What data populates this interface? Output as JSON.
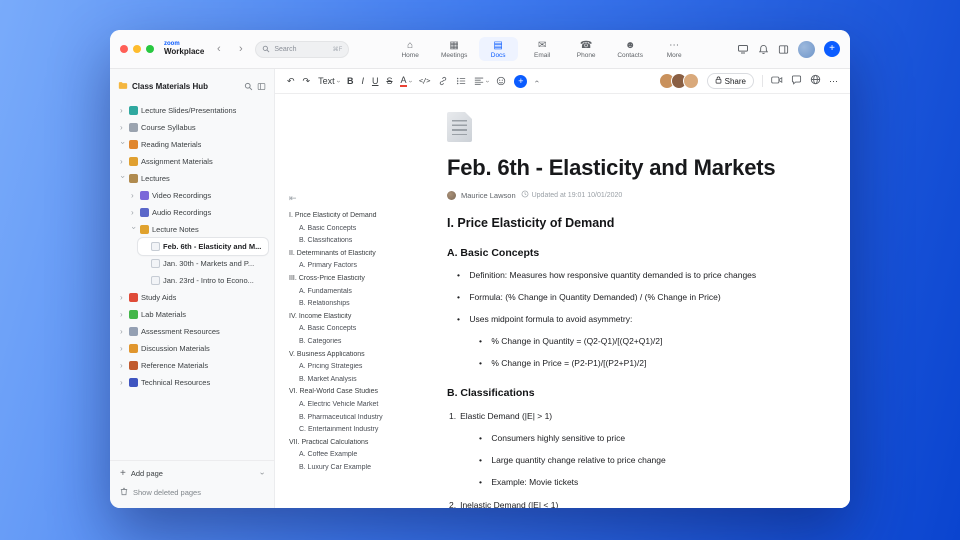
{
  "accent_color": "#0b5cff",
  "window": {
    "traffic_lights": [
      {
        "color": "#ff5f57"
      },
      {
        "color": "#febc2e"
      },
      {
        "color": "#28c840"
      }
    ]
  },
  "topbar": {
    "brand_zoom": "zoom",
    "brand_workplace": "Workplace",
    "search_placeholder": "Search",
    "search_shortcut": "⌘F",
    "tabs": [
      {
        "icon": "⌂",
        "label": "Home",
        "active": false
      },
      {
        "icon": "▦",
        "label": "Meetings",
        "active": false
      },
      {
        "icon": "▤",
        "label": "Docs",
        "active": true
      },
      {
        "icon": "✉",
        "label": "Email",
        "active": false
      },
      {
        "icon": "☎",
        "label": "Phone",
        "active": false
      },
      {
        "icon": "☻",
        "label": "Contacts",
        "active": false
      },
      {
        "icon": "⋯",
        "label": "More",
        "active": false
      }
    ],
    "new_button_label": "+",
    "right_icon_names": [
      "screen-share-icon",
      "bell-icon",
      "panel-layout-icon",
      "user-avatar",
      "new-button"
    ]
  },
  "sidebar": {
    "title": "Class Materials Hub",
    "items": [
      {
        "depth": 0,
        "label": "Lecture Slides/Presentations",
        "color": "#2fa89f"
      },
      {
        "depth": 0,
        "label": "Course Syllabus",
        "color": "#9aa3af"
      },
      {
        "depth": 0,
        "label": "Reading Materials",
        "color": "#e0862e",
        "expanded": true
      },
      {
        "depth": 0,
        "label": "Assignment Materials",
        "color": "#e0a030"
      },
      {
        "depth": 0,
        "label": "Lectures",
        "color": "#b08b4f",
        "expanded": true
      },
      {
        "depth": 1,
        "label": "Video Recordings",
        "color": "#7b68d9"
      },
      {
        "depth": 1,
        "label": "Audio Recordings",
        "color": "#5a67c9"
      },
      {
        "depth": 1,
        "label": "Lecture Notes",
        "color": "#e0a22e",
        "expanded": true
      },
      {
        "depth": 2,
        "label": "Feb. 6th - Elasticity and M...",
        "color": "#f2f4f7",
        "leaf": true,
        "selected": true
      },
      {
        "depth": 2,
        "label": "Jan. 30th - Markets and P...",
        "color": "#f2f4f7",
        "leaf": true
      },
      {
        "depth": 2,
        "label": "Jan. 23rd - Intro to Econo...",
        "color": "#f2f4f7",
        "leaf": true
      },
      {
        "depth": 0,
        "label": "Study Aids",
        "color": "#df4b38"
      },
      {
        "depth": 0,
        "label": "Lab Materials",
        "color": "#43b649"
      },
      {
        "depth": 0,
        "label": "Assessment Resources",
        "color": "#94a0b3"
      },
      {
        "depth": 0,
        "label": "Discussion Materials",
        "color": "#e0962e"
      },
      {
        "depth": 0,
        "label": "Reference Materials",
        "color": "#c05a2e"
      },
      {
        "depth": 0,
        "label": "Technical Resources",
        "color": "#3f55c0"
      }
    ],
    "add_page_label": "Add page",
    "show_deleted_label": "Show deleted pages"
  },
  "toolbar": {
    "undo_glyph": "↶",
    "redo_glyph": "↷",
    "text_style_label": "Text",
    "bold_label": "B",
    "italic_label": "I",
    "underline_label": "U",
    "strike_label": "S",
    "color_label": "A",
    "code_label": "</>",
    "share_label": "Share",
    "more_glyph": "⋯",
    "icon_names": [
      "link-icon",
      "bulleted-list-icon",
      "align-icon",
      "emoji-icon",
      "insert-plus-icon",
      "collapse-toolbar-icon",
      "video-icon",
      "comment-icon",
      "globe-icon",
      "more-icon"
    ],
    "avatars": [
      {
        "color": "#c9915c"
      },
      {
        "color": "#8a5f43"
      },
      {
        "color": "#d9a97b"
      }
    ]
  },
  "document": {
    "title": "Feb. 6th - Elasticity and Markets",
    "author": "Maurice Lawson",
    "updated": "Updated at 19:01 10/01/2020",
    "outline": [
      {
        "level": 1,
        "text": "I. Price Elasticity of Demand"
      },
      {
        "level": 2,
        "text": "A. Basic Concepts"
      },
      {
        "level": 2,
        "text": "B. Classifications"
      },
      {
        "level": 1,
        "text": "II. Determinants of Elasticity"
      },
      {
        "level": 2,
        "text": "A. Primary Factors"
      },
      {
        "level": 1,
        "text": "III. Cross-Price Elasticity"
      },
      {
        "level": 2,
        "text": "A. Fundamentals"
      },
      {
        "level": 2,
        "text": "B. Relationships"
      },
      {
        "level": 1,
        "text": "IV. Income Elasticity"
      },
      {
        "level": 2,
        "text": "A. Basic Concepts"
      },
      {
        "level": 2,
        "text": "B. Categories"
      },
      {
        "level": 1,
        "text": "V. Business Applications"
      },
      {
        "level": 2,
        "text": "A. Pricing Strategies"
      },
      {
        "level": 2,
        "text": "B. Market Analysis"
      },
      {
        "level": 1,
        "text": "VI. Real-World Case Studies"
      },
      {
        "level": 2,
        "text": "A. Electric Vehicle Market"
      },
      {
        "level": 2,
        "text": "B. Pharmaceutical Industry"
      },
      {
        "level": 2,
        "text": "C. Entertainment Industry"
      },
      {
        "level": 1,
        "text": "VII. Practical Calculations"
      },
      {
        "level": 2,
        "text": "A. Coffee Example"
      },
      {
        "level": 2,
        "text": "B. Luxury Car Example"
      }
    ],
    "body": [
      {
        "type": "h1",
        "text": "I. Price Elasticity of Demand"
      },
      {
        "type": "h2",
        "text": "A. Basic Concepts"
      },
      {
        "type": "bullet",
        "depth": 0,
        "text": "Definition: Measures how responsive quantity demanded is to price changes"
      },
      {
        "type": "bullet",
        "depth": 0,
        "text": "Formula: (% Change in Quantity Demanded) / (% Change in Price)"
      },
      {
        "type": "bullet",
        "depth": 0,
        "text": "Uses midpoint formula to avoid asymmetry:"
      },
      {
        "type": "bullet",
        "depth": 1,
        "text": "% Change in Quantity = (Q2-Q1)/[(Q2+Q1)/2]"
      },
      {
        "type": "bullet",
        "depth": 1,
        "text": "% Change in Price = (P2-P1)/[(P2+P1)/2]"
      },
      {
        "type": "h2",
        "text": "B. Classifications"
      },
      {
        "type": "number",
        "num": "1.",
        "text": "Elastic Demand (|E| > 1)"
      },
      {
        "type": "bullet",
        "depth": 1,
        "text": "Consumers highly sensitive to price"
      },
      {
        "type": "bullet",
        "depth": 1,
        "text": "Large quantity change relative to price change"
      },
      {
        "type": "bullet",
        "depth": 1,
        "text": "Example: Movie tickets"
      },
      {
        "type": "number",
        "num": "2.",
        "text": "Inelastic Demand (|E| < 1)"
      }
    ]
  }
}
